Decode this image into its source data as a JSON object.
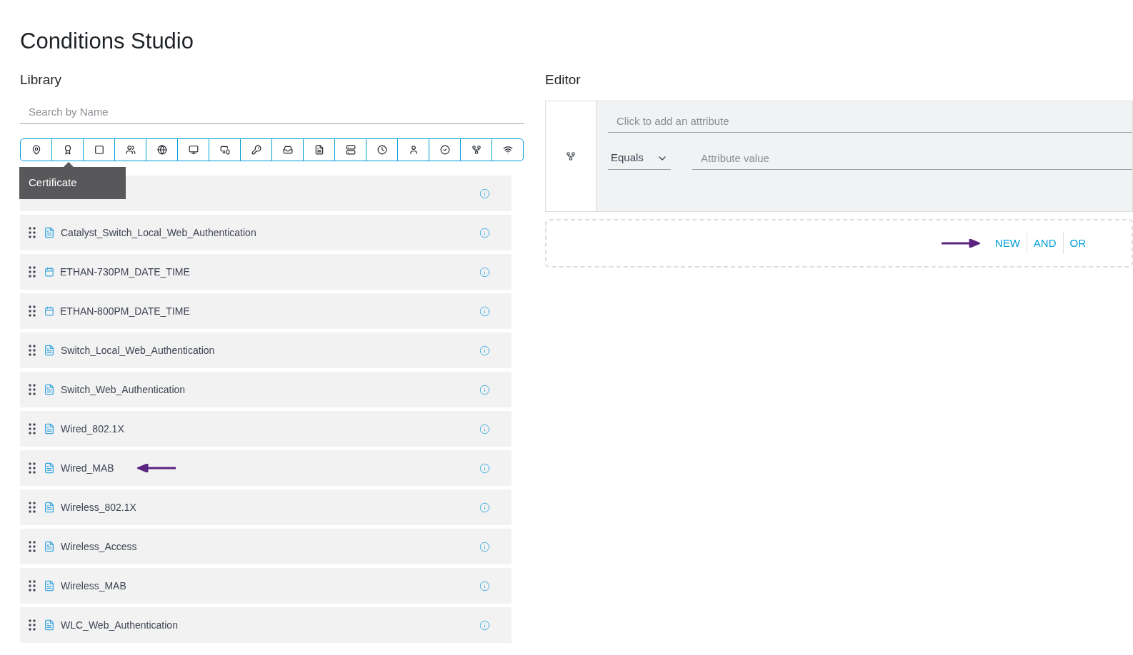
{
  "title": "Conditions Studio",
  "library": {
    "heading": "Library",
    "search": {
      "placeholder": "Search by Name"
    },
    "toolbar": [
      {
        "kind": "location"
      },
      {
        "kind": "certificate"
      },
      {
        "kind": "square"
      },
      {
        "kind": "group"
      },
      {
        "kind": "globe"
      },
      {
        "kind": "network-device"
      },
      {
        "kind": "desktop"
      },
      {
        "kind": "lock"
      },
      {
        "kind": "inbox"
      },
      {
        "kind": "document"
      },
      {
        "kind": "server"
      },
      {
        "kind": "clock"
      },
      {
        "kind": "user"
      },
      {
        "kind": "check"
      },
      {
        "kind": "tree"
      },
      {
        "kind": "wifi"
      }
    ],
    "tooltip": "Certificate",
    "items": [
      {
        "kind": "hidden",
        "arrow": false
      },
      {
        "name": "Catalyst_Switch_Local_Web_Authentication",
        "kind": "document",
        "arrow": false
      },
      {
        "name": "ETHAN-730PM_DATE_TIME",
        "kind": "calendar",
        "arrow": false
      },
      {
        "name": "ETHAN-800PM_DATE_TIME",
        "kind": "calendar",
        "arrow": false
      },
      {
        "name": "Switch_Local_Web_Authentication",
        "kind": "document",
        "arrow": false
      },
      {
        "name": "Switch_Web_Authentication",
        "kind": "document",
        "arrow": false
      },
      {
        "name": "Wired_802.1X",
        "kind": "document",
        "arrow": false
      },
      {
        "name": "Wired_MAB",
        "kind": "document",
        "arrow": true
      },
      {
        "name": "Wireless_802.1X",
        "kind": "document",
        "arrow": false
      },
      {
        "name": "Wireless_Access",
        "kind": "document",
        "arrow": false
      },
      {
        "name": "Wireless_MAB",
        "kind": "document",
        "arrow": false
      },
      {
        "name": "WLC_Web_Authentication",
        "kind": "document",
        "arrow": false
      }
    ]
  },
  "editor": {
    "heading": "Editor",
    "attribute": {
      "placeholder": "Click to add an attribute"
    },
    "operator": "Equals",
    "value": {
      "placeholder": "Attribute value"
    },
    "actions": [
      {
        "label": "NEW",
        "arrow": true
      },
      {
        "label": "AND",
        "arrow": false
      },
      {
        "label": "OR",
        "arrow": false
      }
    ]
  }
}
